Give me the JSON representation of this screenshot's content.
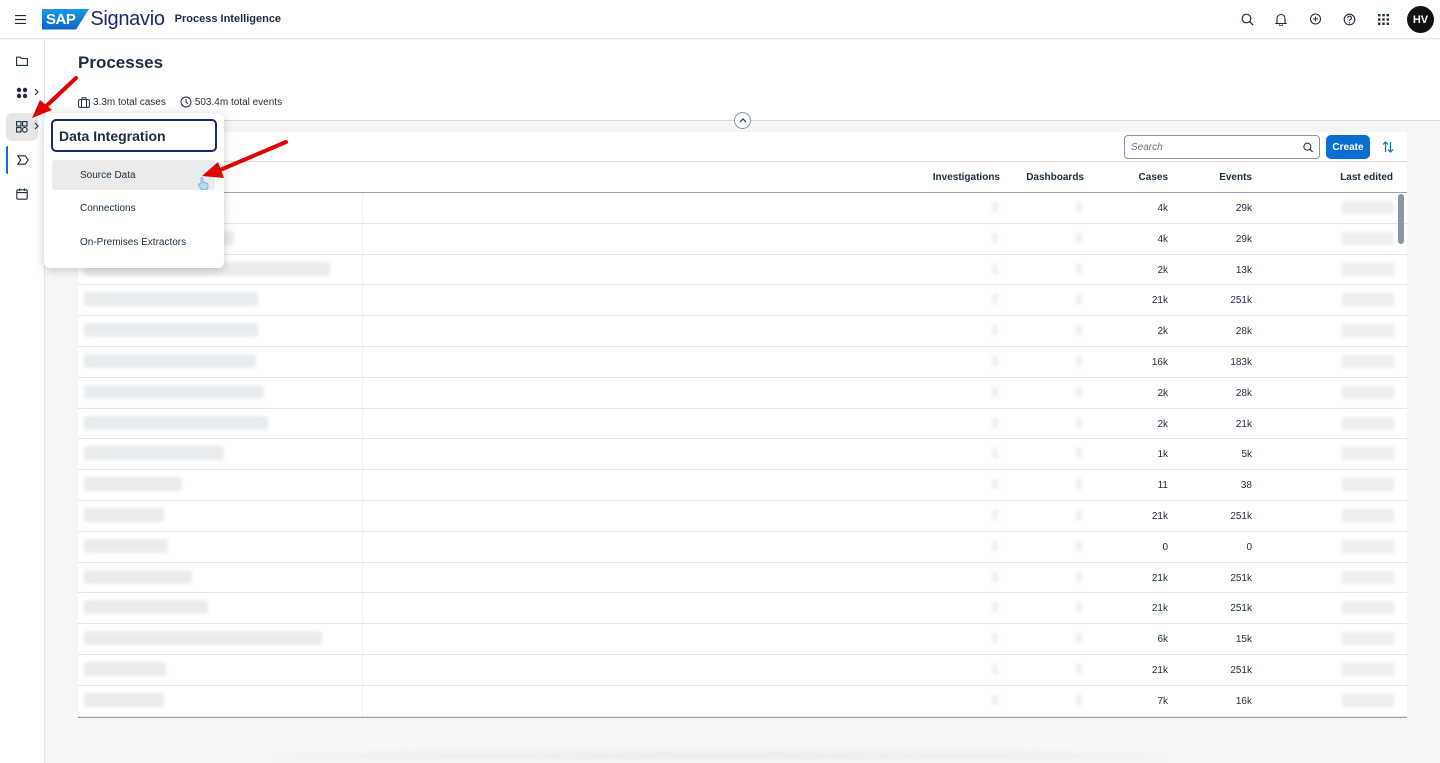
{
  "app": {
    "brand_mark": "SAP",
    "brand_name": "Signavio",
    "product": "Process Intelligence",
    "user_initials": "HV"
  },
  "page": {
    "title": "Processes",
    "total_cases": "3.3m total cases",
    "total_events": "503.4m total events"
  },
  "toolbar": {
    "search_placeholder": "Search",
    "create_label": "Create"
  },
  "table": {
    "columns": [
      "Investigations",
      "Dashboards",
      "Cases",
      "Events",
      "Last edited"
    ],
    "rows": [
      {
        "cases": "4k",
        "events": "29k"
      },
      {
        "cases": "4k",
        "events": "29k"
      },
      {
        "cases": "2k",
        "events": "13k"
      },
      {
        "cases": "21k",
        "events": "251k"
      },
      {
        "cases": "2k",
        "events": "28k"
      },
      {
        "cases": "16k",
        "events": "183k"
      },
      {
        "cases": "2k",
        "events": "28k"
      },
      {
        "cases": "2k",
        "events": "21k"
      },
      {
        "cases": "1k",
        "events": "5k"
      },
      {
        "cases": "11",
        "events": "38"
      },
      {
        "cases": "21k",
        "events": "251k"
      },
      {
        "cases": "0",
        "events": "0"
      },
      {
        "cases": "21k",
        "events": "251k"
      },
      {
        "cases": "21k",
        "events": "251k"
      },
      {
        "cases": "6k",
        "events": "15k"
      },
      {
        "cases": "21k",
        "events": "251k"
      },
      {
        "cases": "7k",
        "events": "16k"
      }
    ]
  },
  "menu": {
    "title": "Data Integration",
    "items": [
      "Source Data",
      "Connections",
      "On-Premises Extractors"
    ]
  },
  "colors": {
    "accent": "#0a6ed1",
    "annotation": "#e00000"
  }
}
